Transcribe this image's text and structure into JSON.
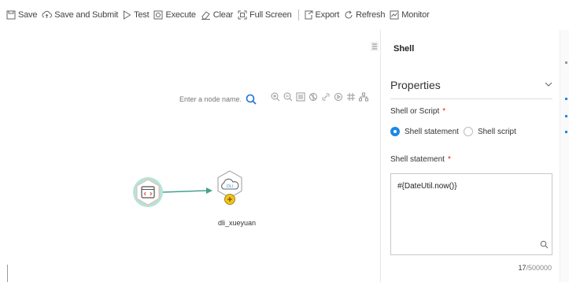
{
  "toolbar": {
    "save": "Save",
    "save_submit": "Save and Submit",
    "test": "Test",
    "execute": "Execute",
    "clear": "Clear",
    "full_screen": "Full Screen",
    "export": "Export",
    "refresh": "Refresh",
    "monitor": "Monitor"
  },
  "canvas": {
    "search_placeholder": "Enter a node name.",
    "nodes": [
      {
        "name": "",
        "type": "shell"
      },
      {
        "name": "dli_xueyuan",
        "type": "dli",
        "icon_text": "DLI"
      }
    ]
  },
  "panel": {
    "title": "Shell",
    "section": "Properties",
    "mode_label": "Shell or Script",
    "required_mark": "*",
    "options": [
      "Shell statement",
      "Shell script"
    ],
    "selected_option": "Shell statement",
    "statement_label": "Shell statement",
    "statement_value": "#{DateUtil.now()}",
    "count": "17",
    "limit": "/500000"
  },
  "colors": {
    "accent": "#1e88e5",
    "node_ring": "#b6e3d8",
    "edge": "#4a9e8e",
    "required": "#e02020",
    "add_badge": "#f4c21c"
  }
}
